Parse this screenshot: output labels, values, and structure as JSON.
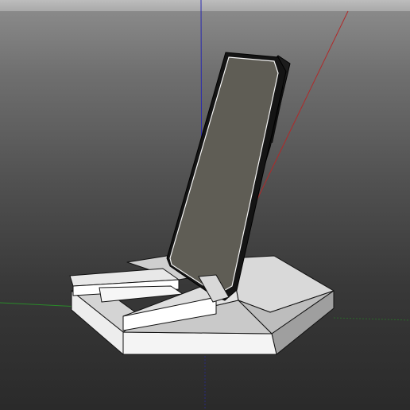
{
  "app": {
    "view": "3D viewport",
    "object": "phone-stand-model"
  },
  "colors": {
    "background_top": "#8e8e8e",
    "background_bottom": "#2a2a2a",
    "axis_x": "#b02a2a",
    "axis_y": "#2a8a2a",
    "axis_z": "#2a2ab0",
    "phone_screen": "#5f5d55",
    "phone_body": "#1a1a1a",
    "stand_light": "#f2f2f2",
    "stand_shade": "#cfcfcf",
    "stand_dark": "#a8a8a8",
    "edge": "#111111"
  },
  "icons": {
    "axis_x": "x-axis-line",
    "axis_y": "y-axis-line",
    "axis_z": "z-axis-line"
  }
}
